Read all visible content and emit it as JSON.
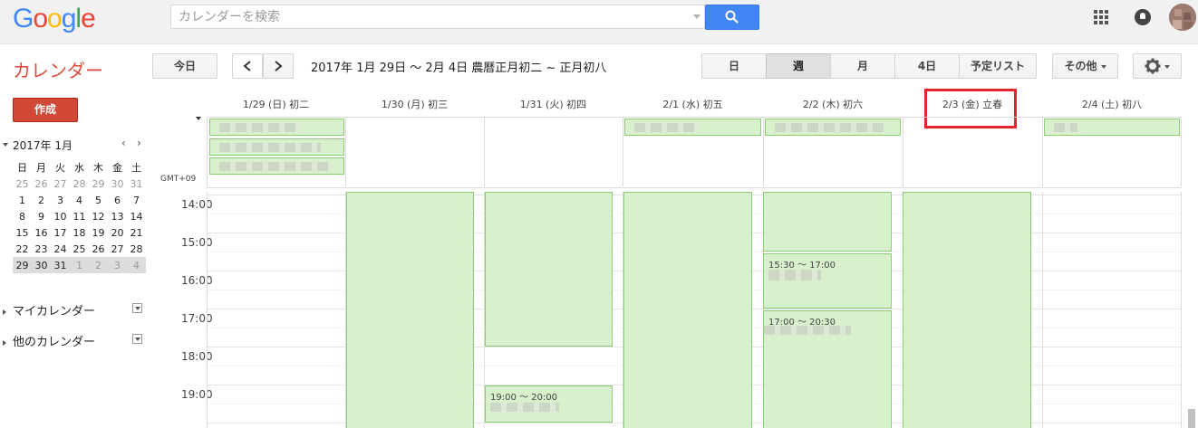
{
  "header": {
    "logo_text": "Google",
    "search_placeholder": "カレンダーを検索",
    "search_button": "search-icon"
  },
  "toolbar": {
    "app_title": "カレンダー",
    "today": "今日",
    "prev": "‹",
    "next": "›",
    "date_range": "2017年 1月 29日 ～ 2月 4日 農曆正月初二 ~ 正月初八",
    "views": {
      "day": "日",
      "week": "週",
      "month": "月",
      "four_day": "4日",
      "agenda": "予定リスト"
    },
    "more": "その他",
    "active_view": "week"
  },
  "sidebar": {
    "create": "作成",
    "mini_cal_title": "2017年 1月",
    "weekdays": [
      "日",
      "月",
      "火",
      "水",
      "木",
      "金",
      "土"
    ],
    "weeks": [
      [
        "25",
        "26",
        "27",
        "28",
        "29",
        "30",
        "31"
      ],
      [
        "1",
        "2",
        "3",
        "4",
        "5",
        "6",
        "7"
      ],
      [
        "8",
        "9",
        "10",
        "11",
        "12",
        "13",
        "14"
      ],
      [
        "15",
        "16",
        "17",
        "18",
        "19",
        "20",
        "21"
      ],
      [
        "22",
        "23",
        "24",
        "25",
        "26",
        "27",
        "28"
      ],
      [
        "29",
        "30",
        "31",
        "1",
        "2",
        "3",
        "4"
      ]
    ],
    "my_calendars": "マイカレンダー",
    "other_calendars": "他のカレンダー"
  },
  "calendar": {
    "days": [
      "1/29 (日) 初二",
      "1/30 (月) 初三",
      "1/31 (火) 初四",
      "2/1 (水) 初五",
      "2/2 (木) 初六",
      "2/3 (金) 立春",
      "2/4 (土) 初八"
    ],
    "highlighted_day": "2/3 (金) 立春",
    "timezone": "GMT+09",
    "hours": [
      "14:00",
      "15:00",
      "16:00",
      "17:00",
      "18:00",
      "19:00"
    ],
    "event_times": {
      "thu_1530": "15:30 ～ 17:00",
      "thu_1700": "17:00 ～ 20:30",
      "tue_1900": "19:00 ～ 20:00"
    }
  },
  "colors": {
    "event_bg": "#d9f0cc",
    "event_border": "#8ccc74",
    "brand_red": "#dd4b39",
    "accent_blue": "#4285f4"
  }
}
